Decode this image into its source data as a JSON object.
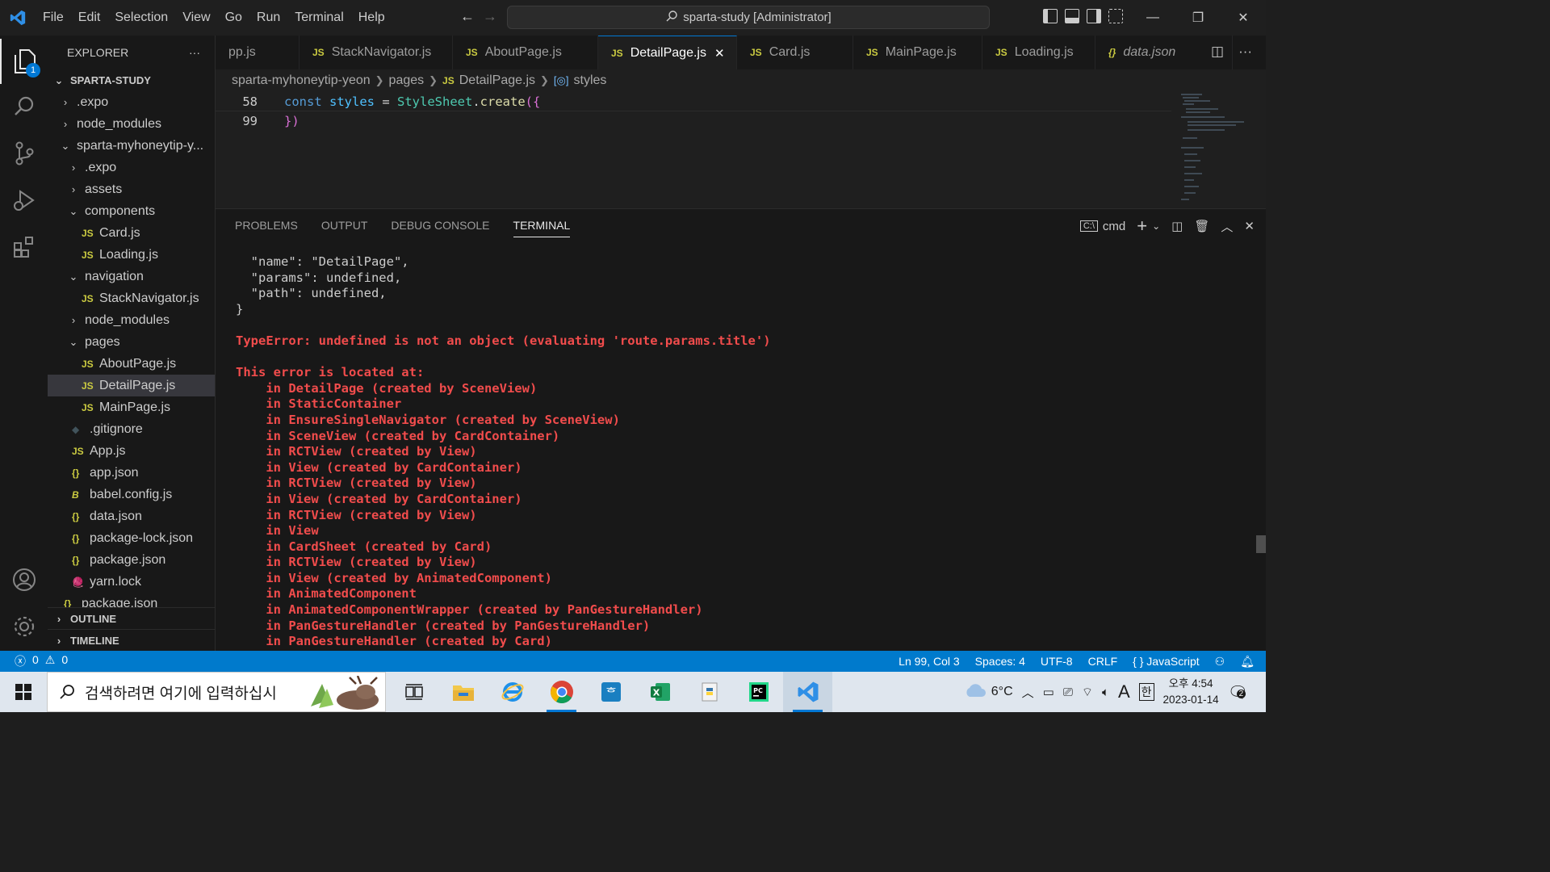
{
  "titlebar": {
    "menu": [
      "File",
      "Edit",
      "Selection",
      "View",
      "Go",
      "Run",
      "Terminal",
      "Help"
    ],
    "search_text": "sparta-study [Administrator]",
    "window_controls": [
      "minimize-icon",
      "restore-icon",
      "close-icon"
    ]
  },
  "activity": {
    "explorer_badge": "1",
    "icons": [
      "files-icon",
      "search-icon",
      "source-control-icon",
      "run-debug-icon",
      "extensions-icon",
      "account-icon",
      "settings-gear-icon"
    ]
  },
  "sidebar": {
    "header": "EXPLORER",
    "more": "···",
    "root": "SPARTA-STUDY",
    "tree": [
      {
        "label": ".expo",
        "indent": 0,
        "chevron": "›",
        "icon": ""
      },
      {
        "label": "node_modules",
        "indent": 0,
        "chevron": "›",
        "icon": ""
      },
      {
        "label": "sparta-myhoneytip-y...",
        "indent": 0,
        "chevron": "⌄",
        "icon": ""
      },
      {
        "label": ".expo",
        "indent": 1,
        "chevron": "›",
        "icon": ""
      },
      {
        "label": "assets",
        "indent": 1,
        "chevron": "›",
        "icon": ""
      },
      {
        "label": "components",
        "indent": 1,
        "chevron": "⌄",
        "icon": ""
      },
      {
        "label": "Card.js",
        "indent": 2,
        "chevron": "",
        "icon": "JS"
      },
      {
        "label": "Loading.js",
        "indent": 2,
        "chevron": "",
        "icon": "JS"
      },
      {
        "label": "navigation",
        "indent": 1,
        "chevron": "⌄",
        "icon": ""
      },
      {
        "label": "StackNavigator.js",
        "indent": 2,
        "chevron": "",
        "icon": "JS"
      },
      {
        "label": "node_modules",
        "indent": 1,
        "chevron": "›",
        "icon": ""
      },
      {
        "label": "pages",
        "indent": 1,
        "chevron": "⌄",
        "icon": ""
      },
      {
        "label": "AboutPage.js",
        "indent": 2,
        "chevron": "",
        "icon": "JS"
      },
      {
        "label": "DetailPage.js",
        "indent": 2,
        "chevron": "",
        "icon": "JS",
        "selected": true
      },
      {
        "label": "MainPage.js",
        "indent": 2,
        "chevron": "",
        "icon": "JS"
      },
      {
        "label": ".gitignore",
        "indent": 1,
        "chevron": "",
        "icon": "◆"
      },
      {
        "label": "App.js",
        "indent": 1,
        "chevron": "",
        "icon": "JS"
      },
      {
        "label": "app.json",
        "indent": 1,
        "chevron": "",
        "icon": "{}"
      },
      {
        "label": "babel.config.js",
        "indent": 1,
        "chevron": "",
        "icon": "B"
      },
      {
        "label": "data.json",
        "indent": 1,
        "chevron": "",
        "icon": "{}"
      },
      {
        "label": "package-lock.json",
        "indent": 1,
        "chevron": "",
        "icon": "{}"
      },
      {
        "label": "package.json",
        "indent": 1,
        "chevron": "",
        "icon": "{}"
      },
      {
        "label": "yarn.lock",
        "indent": 1,
        "chevron": "",
        "icon": "🧶"
      },
      {
        "label": "package.json",
        "indent": 0,
        "chevron": "",
        "icon": "{}"
      }
    ],
    "outline": "OUTLINE",
    "timeline": "TIMELINE"
  },
  "tabs": [
    {
      "label": "pp.js",
      "icon": "",
      "active": false
    },
    {
      "label": "StackNavigator.js",
      "icon": "JS",
      "active": false
    },
    {
      "label": "AboutPage.js",
      "icon": "JS",
      "active": false
    },
    {
      "label": "DetailPage.js",
      "icon": "JS",
      "active": true
    },
    {
      "label": "Card.js",
      "icon": "JS",
      "active": false
    },
    {
      "label": "MainPage.js",
      "icon": "JS",
      "active": false
    },
    {
      "label": "Loading.js",
      "icon": "JS",
      "active": false
    },
    {
      "label": "data.json",
      "icon": "{}",
      "active": false,
      "italic": true
    }
  ],
  "breadcrumb": [
    "sparta-myhoneytip-yeon",
    "pages",
    "DetailPage.js",
    "styles"
  ],
  "editor": {
    "lines": [
      {
        "num": "58",
        "tokens": [
          [
            "kw",
            "const "
          ],
          [
            "var",
            "styles"
          ],
          [
            "op",
            " = "
          ],
          [
            "cls",
            "StyleSheet"
          ],
          [
            "op",
            "."
          ],
          [
            "fn",
            "create"
          ],
          [
            "br",
            "({"
          ]
        ]
      },
      {
        "num": "99",
        "tokens": [
          [
            "br",
            "})"
          ]
        ]
      }
    ]
  },
  "panel": {
    "tabs": [
      "PROBLEMS",
      "OUTPUT",
      "DEBUG CONSOLE",
      "TERMINAL"
    ],
    "active_tab": "TERMINAL",
    "shell": "cmd",
    "terminal_lines": [
      {
        "text": "  \"name\": \"DetailPage\",",
        "error": false
      },
      {
        "text": "  \"params\": undefined,",
        "error": false
      },
      {
        "text": "  \"path\": undefined,",
        "error": false
      },
      {
        "text": "}",
        "error": false
      },
      {
        "text": "",
        "error": false
      },
      {
        "text": "TypeError: undefined is not an object (evaluating 'route.params.title')",
        "error": true
      },
      {
        "text": "",
        "error": false
      },
      {
        "text": "This error is located at:",
        "error": true
      },
      {
        "text": "    in DetailPage (created by SceneView)",
        "error": true
      },
      {
        "text": "    in StaticContainer",
        "error": true
      },
      {
        "text": "    in EnsureSingleNavigator (created by SceneView)",
        "error": true
      },
      {
        "text": "    in SceneView (created by CardContainer)",
        "error": true
      },
      {
        "text": "    in RCTView (created by View)",
        "error": true
      },
      {
        "text": "    in View (created by CardContainer)",
        "error": true
      },
      {
        "text": "    in RCTView (created by View)",
        "error": true
      },
      {
        "text": "    in View (created by CardContainer)",
        "error": true
      },
      {
        "text": "    in RCTView (created by View)",
        "error": true
      },
      {
        "text": "    in View",
        "error": true
      },
      {
        "text": "    in CardSheet (created by Card)",
        "error": true
      },
      {
        "text": "    in RCTView (created by View)",
        "error": true
      },
      {
        "text": "    in View (created by AnimatedComponent)",
        "error": true
      },
      {
        "text": "    in AnimatedComponent",
        "error": true
      },
      {
        "text": "    in AnimatedComponentWrapper (created by PanGestureHandler)",
        "error": true
      },
      {
        "text": "    in PanGestureHandler (created by PanGestureHandler)",
        "error": true
      },
      {
        "text": "    in PanGestureHandler (created by Card)",
        "error": true
      }
    ]
  },
  "statusbar": {
    "errors": "0",
    "warnings": "0",
    "position": "Ln 99, Col 3",
    "spaces": "Spaces: 4",
    "encoding": "UTF-8",
    "eol": "CRLF",
    "language": "JavaScript"
  },
  "taskbar": {
    "search_placeholder": "검색하려면 여기에 입력하십시",
    "weather": "6°C",
    "ime_a": "A",
    "ime_lang": "한",
    "time": "오후 4:54",
    "date": "2023-01-14",
    "notifications": "2"
  },
  "colors": {
    "accent": "#0078d4",
    "statusbar": "#007acc",
    "error": "#f14c4c",
    "js_icon": "#cbcb41"
  }
}
